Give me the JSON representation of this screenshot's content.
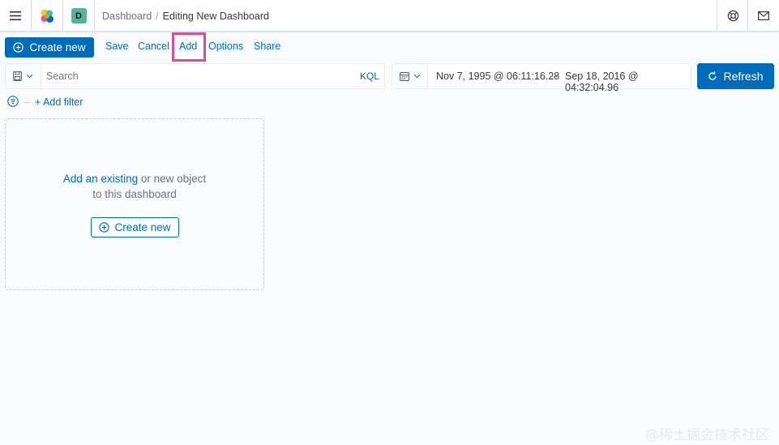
{
  "header": {
    "breadcrumbs": [
      "Dashboard",
      "Editing New Dashboard"
    ],
    "breadcrumb_separator": "/",
    "space_initial": "D",
    "space_color": "#54b399"
  },
  "toolbar": {
    "create_new_label": "Create new",
    "save_label": "Save",
    "cancel_label": "Cancel",
    "add_label": "Add",
    "options_label": "Options",
    "share_label": "Share",
    "highlight_color": "#d4508f"
  },
  "query": {
    "search_placeholder": "Search",
    "language_label": "KQL"
  },
  "date_picker": {
    "start": "Nov 7, 1995 @ 06:11:16.28",
    "arrow": "→",
    "end": "Sep 18, 2016 @ 04:32:04.96",
    "refresh_label": "Refresh"
  },
  "filters": {
    "add_filter_label": "+ Add filter"
  },
  "empty_panel": {
    "link_text": "Add an existing",
    "text_after_link": " or new object",
    "line2": "to this dashboard",
    "create_new_label": "Create new"
  },
  "watermark": "@稀土掘金技术社区",
  "colors": {
    "primary": "#006bb8",
    "background": "#fafbfd"
  }
}
